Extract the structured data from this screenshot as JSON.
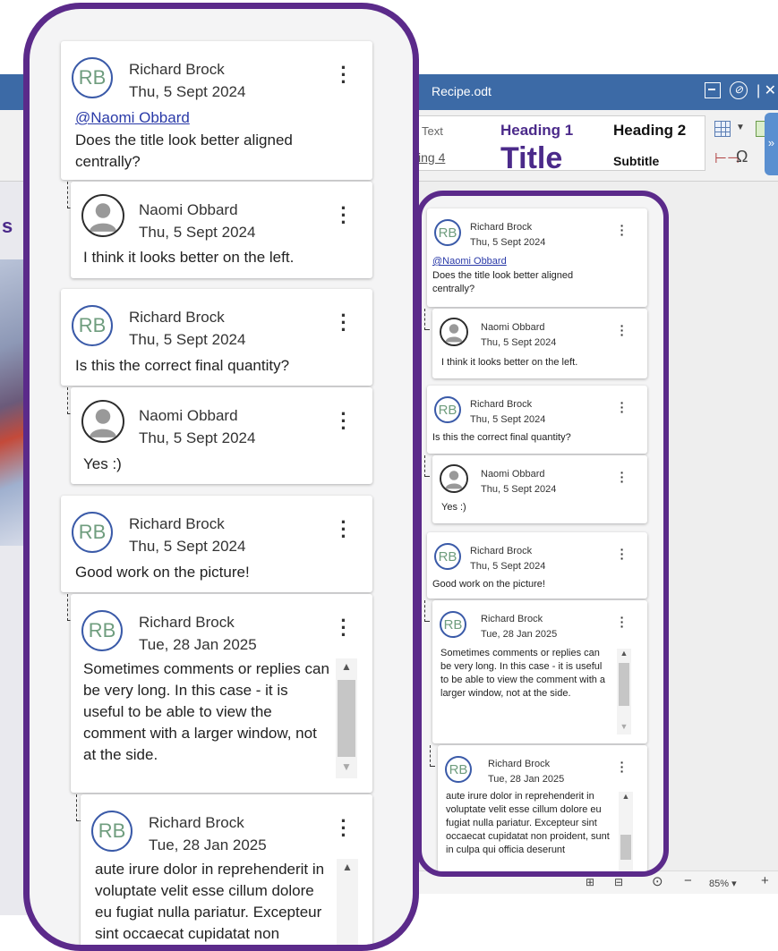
{
  "app": {
    "document_title": "Recipe.odt",
    "styles": {
      "text": "Text",
      "heading1": "Heading 1",
      "heading2": "Heading 2",
      "heading4": "ing 4",
      "title": "Title",
      "subtitle": "Subtitle"
    },
    "zoom": "85% ▾",
    "left_fragment_heading": "s"
  },
  "comments": {
    "c1": {
      "author": "Richard Brock",
      "initials": "RB",
      "date": "Thu, 5 Sept 2024",
      "mention": "@Naomi Obbard",
      "text": " Does the title look better aligned centrally?"
    },
    "c1_reply": {
      "author": "Naomi Obbard",
      "date": "Thu, 5 Sept 2024",
      "text": "I think it looks better on the left."
    },
    "c2": {
      "author": "Richard Brock",
      "initials": "RB",
      "date": "Thu, 5 Sept 2024",
      "text": "Is this the correct final quantity?"
    },
    "c2_reply": {
      "author": "Naomi Obbard",
      "date": "Thu, 5 Sept 2024",
      "text": "Yes :)"
    },
    "c3": {
      "author": "Richard Brock",
      "initials": "RB",
      "date": "Thu, 5 Sept 2024",
      "text": "Good work on the picture!"
    },
    "c3_reply1": {
      "author": "Richard Brock",
      "initials": "RB",
      "date": "Tue, 28 Jan 2025",
      "text": "Sometimes comments or replies can be very long. In this case - it is useful to be able to view the comment with a larger window, not at the side."
    },
    "c3_reply2": {
      "author": "Richard Brock",
      "initials": "RB",
      "date": "Tue, 28 Jan 2025",
      "text": "aute irure dolor in reprehenderit in voluptate velit esse cillum dolore eu fugiat nulla pariatur. Excepteur sint occaecat cupidatat non proident, sunt in culpa qui officia deserunt"
    }
  },
  "colors": {
    "panel_border": "#5b2a8a",
    "title_bar": "#3c6aa6",
    "avatar_ring": "#3a5aa8",
    "avatar_initials": "#6f9d7e",
    "mention": "#2a3aa8"
  },
  "icons": {
    "menu": "kebab-menu-icon",
    "user_avatar": "user-silhouette-icon",
    "scroll_up": "scroll-up-arrow-icon",
    "scroll_down": "scroll-down-arrow-icon"
  }
}
